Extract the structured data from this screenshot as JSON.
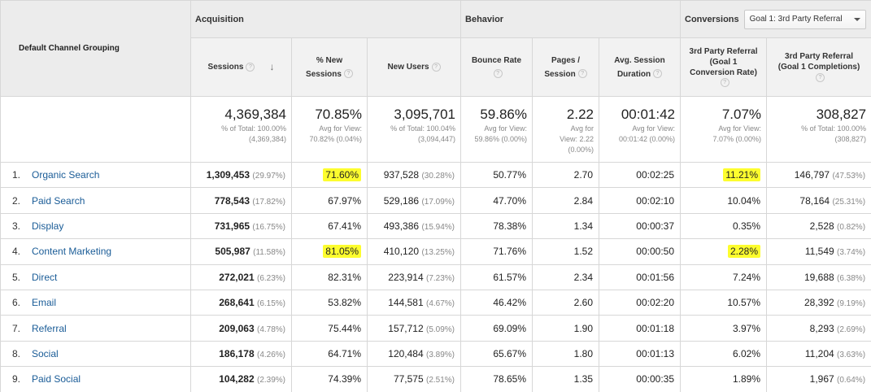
{
  "corner_label": "Default Channel Grouping",
  "groups": {
    "acquisition": "Acquisition",
    "behavior": "Behavior",
    "conversions": "Conversions",
    "goal_dropdown": "Goal 1: 3rd Party Referral"
  },
  "columns": {
    "sessions": "Sessions",
    "new_sessions_1": "% New",
    "new_sessions_2": "Sessions",
    "new_users": "New Users",
    "bounce_rate": "Bounce Rate",
    "pages_1": "Pages /",
    "pages_2": "Session",
    "avg_dur_1": "Avg. Session",
    "avg_dur_2": "Duration",
    "conv_rate_1": "3rd Party Referral",
    "conv_rate_2": "(Goal 1",
    "conv_rate_3": "Conversion Rate)",
    "completions_1": "3rd Party Referral",
    "completions_2": "(Goal 1 Completions)"
  },
  "help_glyph": "?",
  "sort_glyph": "↓",
  "totals": {
    "sessions": {
      "value": "4,369,384",
      "sub1": "% of Total: 100.00%",
      "sub2": "(4,369,384)"
    },
    "new_sessions": {
      "value": "70.85%",
      "sub1": "Avg for View:",
      "sub2": "70.82% (0.04%)"
    },
    "new_users": {
      "value": "3,095,701",
      "sub1": "% of Total: 100.04%",
      "sub2": "(3,094,447)"
    },
    "bounce_rate": {
      "value": "59.86%",
      "sub1": "Avg for View:",
      "sub2": "59.86% (0.00%)"
    },
    "pages": {
      "value": "2.22",
      "sub1": "Avg for",
      "sub2": "View: 2.22",
      "sub3": "(0.00%)"
    },
    "avg_dur": {
      "value": "00:01:42",
      "sub1": "Avg for View:",
      "sub2": "00:01:42 (0.00%)"
    },
    "conv_rate": {
      "value": "7.07%",
      "sub1": "Avg for View:",
      "sub2": "7.07% (0.00%)"
    },
    "completions": {
      "value": "308,827",
      "sub1": "% of Total: 100.00%",
      "sub2": "(308,827)"
    }
  },
  "rows": [
    {
      "idx": "1.",
      "channel": "Organic Search",
      "sessions": "1,309,453",
      "sessions_pct": "(29.97%)",
      "new_sessions": "71.60%",
      "new_users": "937,528",
      "new_users_pct": "(30.28%)",
      "bounce": "50.77%",
      "pages": "2.70",
      "dur": "00:02:25",
      "conv": "11.21%",
      "comp": "146,797",
      "comp_pct": "(47.53%)"
    },
    {
      "idx": "2.",
      "channel": "Paid Search",
      "sessions": "778,543",
      "sessions_pct": "(17.82%)",
      "new_sessions": "67.97%",
      "new_users": "529,186",
      "new_users_pct": "(17.09%)",
      "bounce": "47.70%",
      "pages": "2.84",
      "dur": "00:02:10",
      "conv": "10.04%",
      "comp": "78,164",
      "comp_pct": "(25.31%)"
    },
    {
      "idx": "3.",
      "channel": "Display",
      "sessions": "731,965",
      "sessions_pct": "(16.75%)",
      "new_sessions": "67.41%",
      "new_users": "493,386",
      "new_users_pct": "(15.94%)",
      "bounce": "78.38%",
      "pages": "1.34",
      "dur": "00:00:37",
      "conv": "0.35%",
      "comp": "2,528",
      "comp_pct": "(0.82%)"
    },
    {
      "idx": "4.",
      "channel": "Content Marketing",
      "sessions": "505,987",
      "sessions_pct": "(11.58%)",
      "new_sessions": "81.05%",
      "new_users": "410,120",
      "new_users_pct": "(13.25%)",
      "bounce": "71.76%",
      "pages": "1.52",
      "dur": "00:00:50",
      "conv": "2.28%",
      "comp": "11,549",
      "comp_pct": "(3.74%)"
    },
    {
      "idx": "5.",
      "channel": "Direct",
      "sessions": "272,021",
      "sessions_pct": "(6.23%)",
      "new_sessions": "82.31%",
      "new_users": "223,914",
      "new_users_pct": "(7.23%)",
      "bounce": "61.57%",
      "pages": "2.34",
      "dur": "00:01:56",
      "conv": "7.24%",
      "comp": "19,688",
      "comp_pct": "(6.38%)"
    },
    {
      "idx": "6.",
      "channel": "Email",
      "sessions": "268,641",
      "sessions_pct": "(6.15%)",
      "new_sessions": "53.82%",
      "new_users": "144,581",
      "new_users_pct": "(4.67%)",
      "bounce": "46.42%",
      "pages": "2.60",
      "dur": "00:02:20",
      "conv": "10.57%",
      "comp": "28,392",
      "comp_pct": "(9.19%)"
    },
    {
      "idx": "7.",
      "channel": "Referral",
      "sessions": "209,063",
      "sessions_pct": "(4.78%)",
      "new_sessions": "75.44%",
      "new_users": "157,712",
      "new_users_pct": "(5.09%)",
      "bounce": "69.09%",
      "pages": "1.90",
      "dur": "00:01:18",
      "conv": "3.97%",
      "comp": "8,293",
      "comp_pct": "(2.69%)"
    },
    {
      "idx": "8.",
      "channel": "Social",
      "sessions": "186,178",
      "sessions_pct": "(4.26%)",
      "new_sessions": "64.71%",
      "new_users": "120,484",
      "new_users_pct": "(3.89%)",
      "bounce": "65.67%",
      "pages": "1.80",
      "dur": "00:01:13",
      "conv": "6.02%",
      "comp": "11,204",
      "comp_pct": "(3.63%)"
    },
    {
      "idx": "9.",
      "channel": "Paid Social",
      "sessions": "104,282",
      "sessions_pct": "(2.39%)",
      "new_sessions": "74.39%",
      "new_users": "77,575",
      "new_users_pct": "(2.51%)",
      "bounce": "78.65%",
      "pages": "1.35",
      "dur": "00:00:35",
      "conv": "1.89%",
      "comp": "1,967",
      "comp_pct": "(0.64%)"
    }
  ],
  "highlights": [
    {
      "row": 0,
      "col": "new_sessions"
    },
    {
      "row": 0,
      "col": "conv"
    },
    {
      "row": 3,
      "col": "new_sessions"
    },
    {
      "row": 3,
      "col": "conv"
    }
  ],
  "colors": {
    "link": "#1a5c97",
    "highlight": "#fdfd2e",
    "header_bg": "#ececec"
  }
}
